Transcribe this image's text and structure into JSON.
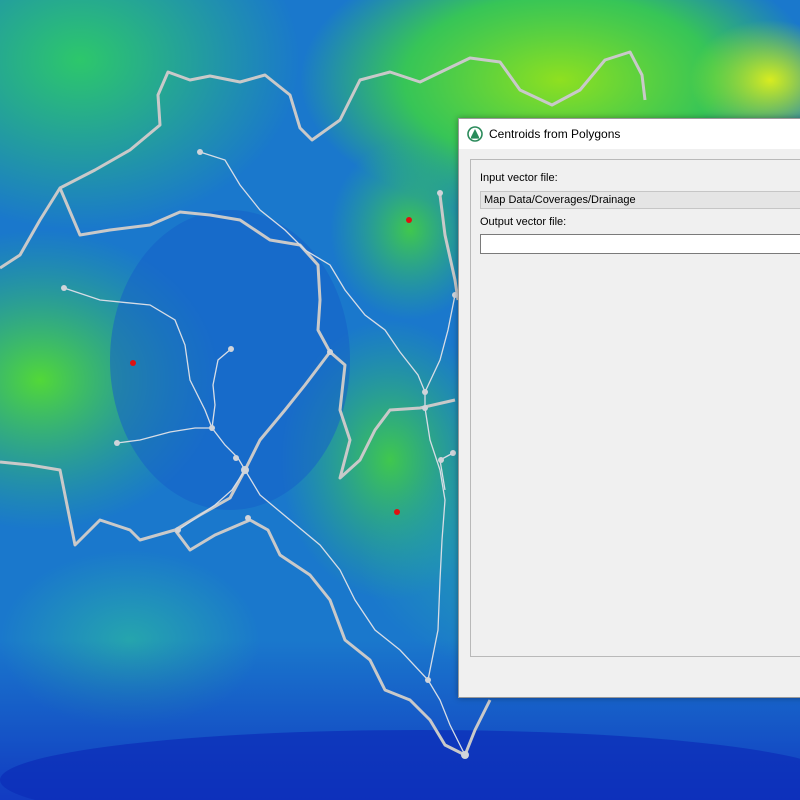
{
  "map": {
    "elevation_colors": [
      "#1030c0",
      "#1a6fd0",
      "#1e9ac0",
      "#2cc06a",
      "#3ed83a",
      "#c8e820"
    ],
    "boundary_color": "#c9c9c9",
    "stream_color": "#d7dde6",
    "centroid_color": "#e01010"
  },
  "dialog": {
    "title": "Centroids from Polygons",
    "icon": "qgis-app-icon",
    "input_label": "Input vector file:",
    "input_value": "Map Data/Coverages/Drainage",
    "output_label": "Output vector file:",
    "output_value": ""
  }
}
